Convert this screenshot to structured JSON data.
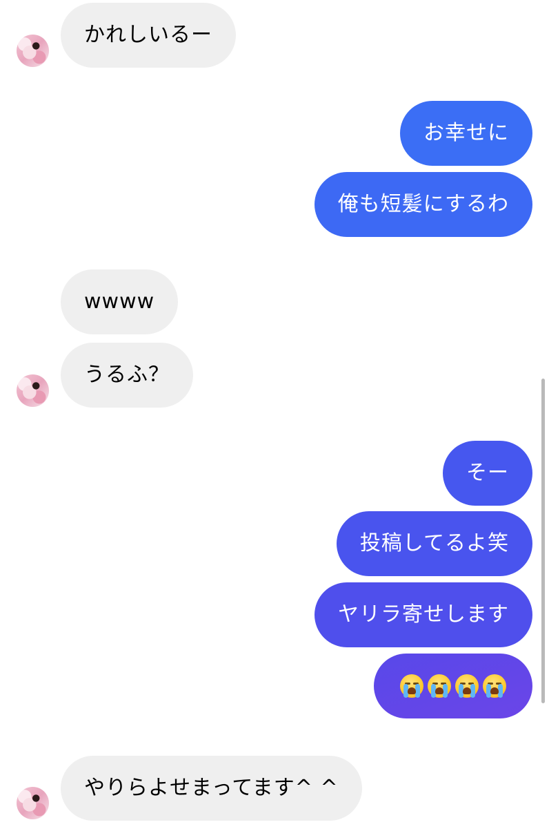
{
  "messages": [
    {
      "side": "incoming",
      "text": "かれしいるー"
    },
    {
      "side": "outgoing",
      "text": "お幸せに",
      "color": "#3b6ef5"
    },
    {
      "side": "outgoing",
      "text": "俺も短髪にするわ",
      "color": "#3d69f4"
    },
    {
      "side": "incoming",
      "text": "wwww"
    },
    {
      "side": "incoming",
      "text": "うるふ？"
    },
    {
      "side": "outgoing",
      "text": "そー",
      "color": "#4657ef"
    },
    {
      "side": "outgoing",
      "text": "投稿してるよ笑",
      "color": "#4954ee"
    },
    {
      "side": "outgoing",
      "text": "ヤリラ寄せします",
      "color": "#4f4fec"
    },
    {
      "side": "outgoing",
      "emoji": [
        "loudly-crying-face",
        "loudly-crying-face",
        "loudly-crying-face",
        "loudly-crying-face"
      ],
      "color": "#5848e9"
    },
    {
      "side": "incoming",
      "text": "やりらよせまってます^ ^"
    }
  ],
  "colors": {
    "incoming_bubble": "#efefef",
    "incoming_text": "#000000",
    "outgoing_text": "#ffffff",
    "gradient_top": "#3a6ff5",
    "gradient_bottom": "#6a45e8"
  }
}
